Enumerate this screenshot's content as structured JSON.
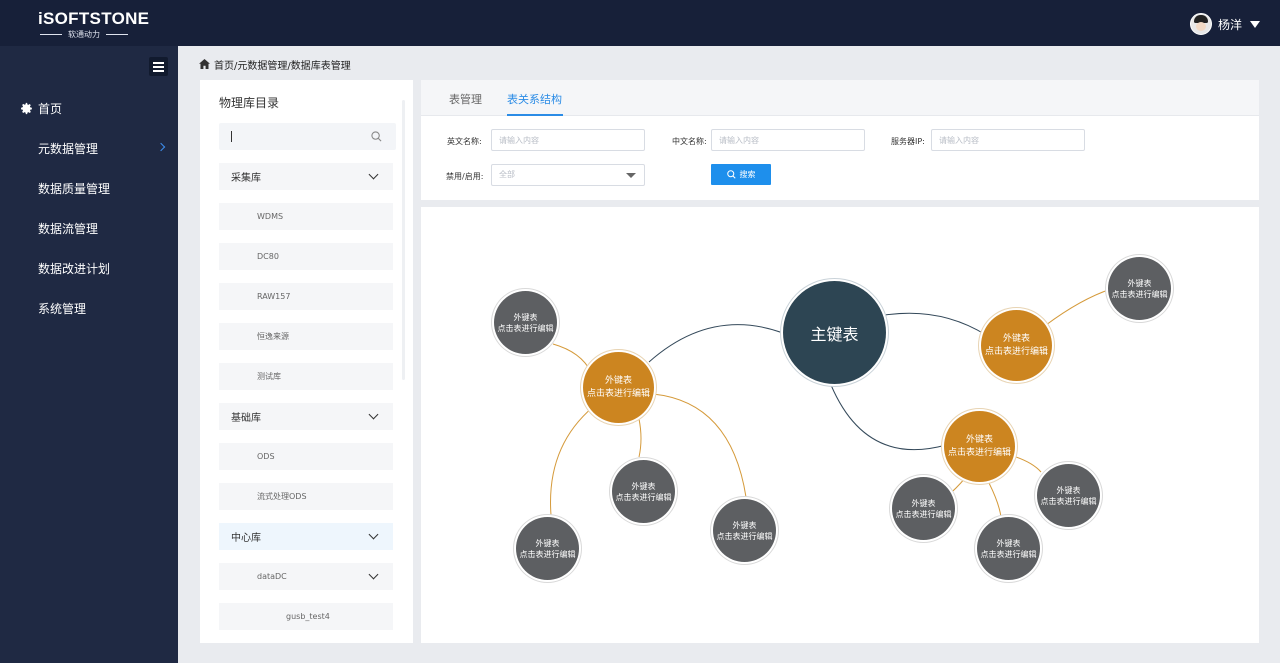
{
  "app": {
    "logo_text": "iSOFTSTONE",
    "logo_sub": "软通动力",
    "user_name": "杨洋"
  },
  "sidebar": {
    "items": [
      {
        "label": "首页",
        "icon": "gear-icon"
      },
      {
        "label": "元数据管理",
        "icon": "chevron-right-icon"
      },
      {
        "label": "数据质量管理"
      },
      {
        "label": "数据流管理"
      },
      {
        "label": "数据改进计划"
      },
      {
        "label": "系统管理"
      }
    ]
  },
  "breadcrumb": "首页/元数据管理/数据库表管理",
  "catalog": {
    "title": "物理库目录",
    "search_value": "",
    "groups": [
      {
        "label": "采集库",
        "children": [
          "WDMS",
          "DC80",
          "RAW157",
          "恒逸来源",
          "测试库"
        ]
      },
      {
        "label": "基础库",
        "children": [
          "ODS",
          "流式处理ODS"
        ]
      },
      {
        "label": "中心库",
        "children": [
          {
            "label": "dataDC",
            "children": [
              "gusb_test4"
            ]
          }
        ]
      }
    ]
  },
  "tabs": [
    {
      "label": "表管理",
      "active": false
    },
    {
      "label": "表关系结构",
      "active": true
    }
  ],
  "filters": {
    "en_name_label": "英文名称:",
    "en_name_placeholder": "请输入内容",
    "cn_name_label": "中文名称:",
    "cn_name_placeholder": "请输入内容",
    "server_ip_label": "服务器IP:",
    "server_ip_placeholder": "请输入内容",
    "status_label": "禁用/启用:",
    "status_value": "全部",
    "search_button": "搜索"
  },
  "graph": {
    "main_node": "主键表",
    "node_line1": "外键表",
    "node_line2": "点击表进行编辑",
    "colors": {
      "main": "#2d4553",
      "orange": "#cc8520",
      "gray": "#5d5f62",
      "main_edge": "#34495a",
      "orange_edge": "#d59a3a"
    }
  },
  "colors": {
    "topbar": "#172039",
    "sidebar": "#1f2943",
    "accent": "#2b8ce6",
    "button": "#1e8fec"
  }
}
